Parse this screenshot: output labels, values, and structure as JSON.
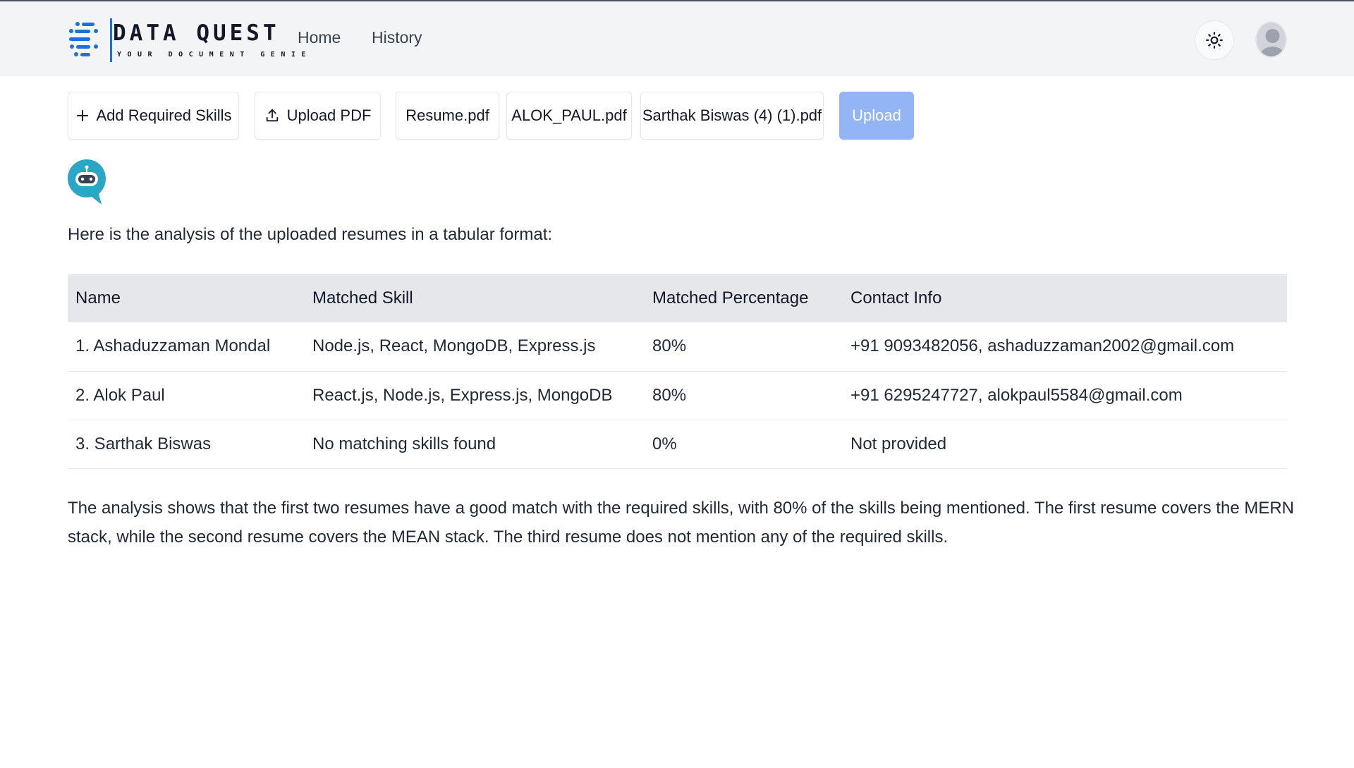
{
  "header": {
    "logo_title": "DATA QUEST",
    "logo_subtitle": "YOUR DOCUMENT GENIE",
    "nav": [
      {
        "label": "Home"
      },
      {
        "label": "History"
      }
    ],
    "theme_icon": "sun-icon",
    "avatar_icon": "user-avatar-icon"
  },
  "toolbar": {
    "add_skills_label": "Add Required Skills",
    "upload_pdf_label": "Upload PDF",
    "files": [
      "Resume.pdf",
      "ALOK_PAUL.pdf",
      "Sarthak Biswas (4) (1).pdf"
    ],
    "upload_label": "Upload",
    "upload_color": "#93b4f5"
  },
  "chat": {
    "bot_icon": "robot-icon",
    "intro": "Here is the analysis of the uploaded resumes in a tabular format:",
    "table": {
      "headers": [
        "Name",
        "Matched Skill",
        "Matched Percentage",
        "Contact Info"
      ],
      "rows": [
        [
          "1. Ashaduzzaman Mondal",
          "Node.js, React, MongoDB, Express.js",
          "80%",
          "+91 9093482056, ashaduzzaman2002@gmail.com"
        ],
        [
          "2. Alok Paul",
          "React.js, Node.js, Express.js, MongoDB",
          "80%",
          "+91 6295247727, alokpaul5584@gmail.com"
        ],
        [
          "3. Sarthak Biswas",
          "No matching skills found",
          "0%",
          "Not provided"
        ]
      ]
    },
    "summary": "The analysis shows that the first two resumes have a good match with the required skills, with 80% of the skills being mentioned. The first resume covers the MERN stack, while the second resume covers the MEAN stack. The third resume does not mention any of the required skills."
  },
  "colors": {
    "header_bg": "#f3f4f6",
    "bot_accent": "#2aa6c6"
  }
}
